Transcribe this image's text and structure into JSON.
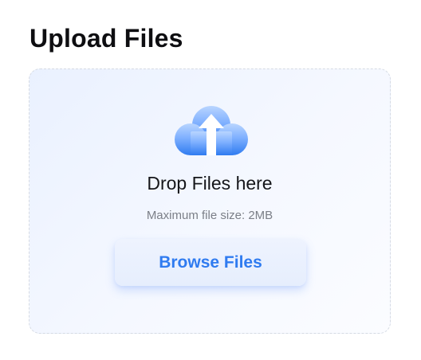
{
  "page": {
    "title": "Upload Files"
  },
  "dropzone": {
    "icon": "cloud-upload-icon",
    "primary_text": "Drop Files here",
    "hint_text": "Maximum file size: 2MB",
    "browse_label": "Browse Files"
  },
  "colors": {
    "accent": "#2f7bf0",
    "icon_gradient_top": "#9cc2ff",
    "icon_gradient_bottom": "#2f7bf0",
    "dropzone_border": "#d5dae3",
    "dropzone_background": "#eef3ff"
  }
}
